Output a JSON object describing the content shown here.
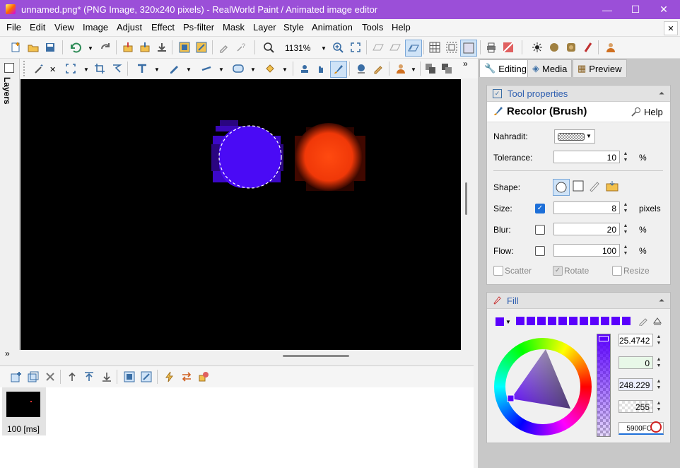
{
  "window": {
    "title": "unnamed.png* (PNG Image, 320x240 pixels) - RealWorld Paint / Animated image editor",
    "minimize": "—",
    "maximize": "☐",
    "close": "✕"
  },
  "menu": [
    "File",
    "Edit",
    "View",
    "Image",
    "Adjust",
    "Effect",
    "Ps-filter",
    "Mask",
    "Layer",
    "Style",
    "Animation",
    "Tools",
    "Help"
  ],
  "menu_close": "✕",
  "toolbar": {
    "zoom": "1131%"
  },
  "left_strip": {
    "layers_label": "Layers",
    "expand": "»"
  },
  "tabs": {
    "editing": "Editing",
    "media": "Media",
    "preview": "Preview"
  },
  "tool_properties": {
    "header": "Tool properties",
    "tool_name": "Recolor (Brush)",
    "help": "Help",
    "nahradit_label": "Nahradit:",
    "tolerance_label": "Tolerance:",
    "tolerance_value": "10",
    "tolerance_unit": "%",
    "shape_label": "Shape:",
    "size_label": "Size:",
    "size_value": "8",
    "size_unit": "pixels",
    "blur_label": "Blur:",
    "blur_value": "20",
    "blur_unit": "%",
    "flow_label": "Flow:",
    "flow_value": "100",
    "flow_unit": "%",
    "scatter": "Scatter",
    "rotate": "Rotate",
    "resize": "Resize"
  },
  "fill": {
    "header": "Fill",
    "hue": "25.4742",
    "saturation": "0",
    "value": "248.229",
    "alpha": "255",
    "hex": "5900FC",
    "color": "#5a00fc"
  },
  "frames": [
    {
      "duration": "100 [ms]"
    }
  ],
  "canvas": {
    "blue_circle": "#4a0af5",
    "red_circle": "#ff3a0a"
  }
}
